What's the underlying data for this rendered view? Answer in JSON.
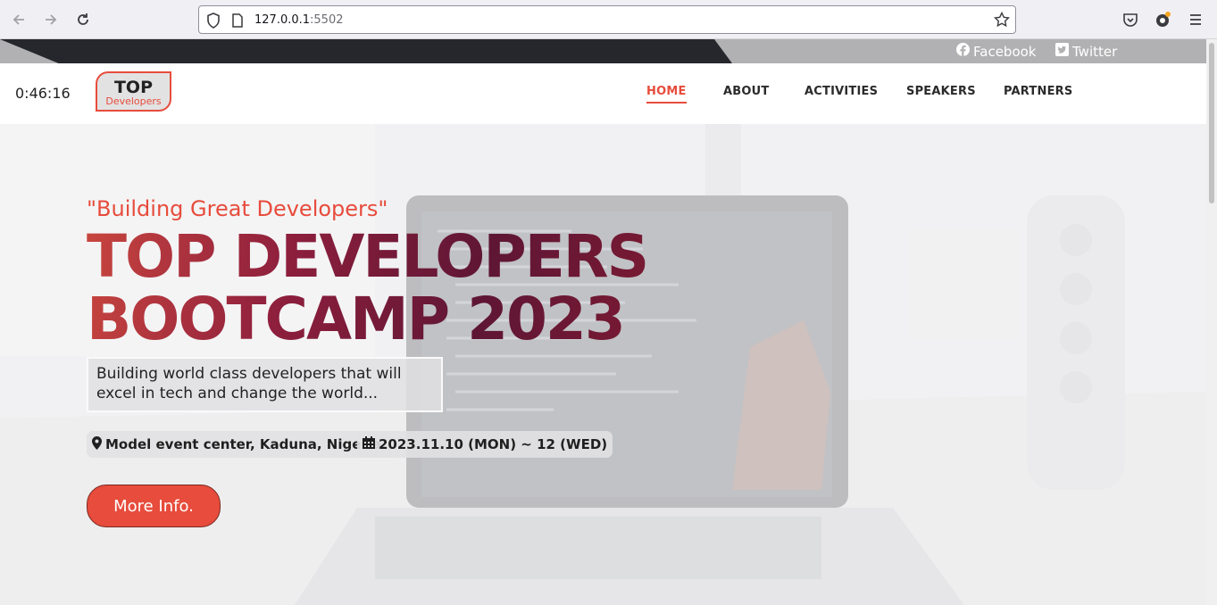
{
  "browser": {
    "url_host": "127.0.0.1",
    "url_port": ":5502",
    "icons": [
      "back-arrow-icon",
      "forward-arrow-icon",
      "reload-icon",
      "shield-icon",
      "page-icon",
      "bookmark-star-icon",
      "pocket-icon",
      "extension-icon",
      "menu-icon"
    ]
  },
  "social": {
    "facebook": "Facebook",
    "twitter": "Twitter"
  },
  "header": {
    "clock": "0:46:16",
    "logo_top": "TOP",
    "logo_sub": "Developers",
    "nav": [
      {
        "label": "HOME",
        "active": true
      },
      {
        "label": "ABOUT",
        "active": false
      },
      {
        "label": "ACTIVITIES",
        "active": false
      },
      {
        "label": "SPEAKERS",
        "active": false
      },
      {
        "label": "PARTNERS",
        "active": false
      }
    ]
  },
  "hero": {
    "tagline": "\"Building Great Developers\"",
    "title_line1": "TOP DEVELOPERS",
    "title_line2": "BOOTCAMP 2023",
    "description": "Building world class developers that will excel in tech and change the world...",
    "location": "Model event center, Kaduna, Nigeria.",
    "date": "2023.11.10 (MON) ~ 12 (WED)",
    "button": "More Info."
  },
  "colors": {
    "accent": "#e74c3c",
    "title_dark": "#7a1a33",
    "social_dark": "#25272c"
  }
}
